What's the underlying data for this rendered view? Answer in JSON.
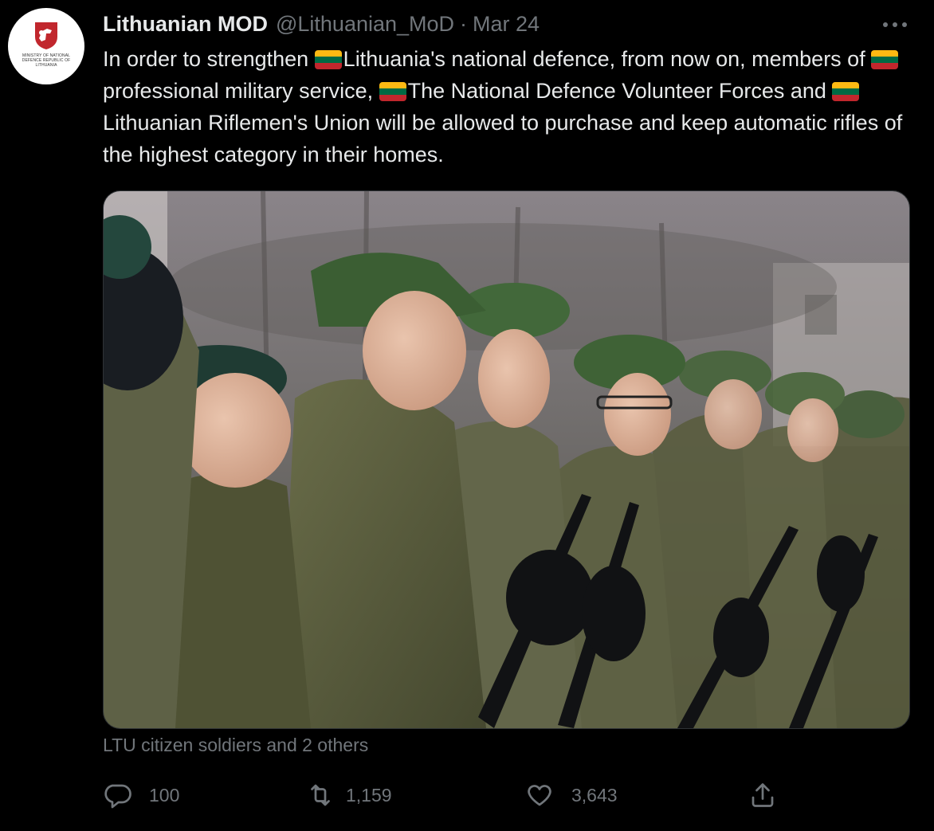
{
  "author": {
    "display_name": "Lithuanian MOD",
    "handle": "@Lithuanian_MoD",
    "separator": "·",
    "date": "Mar 24",
    "avatar_caption": "Ministry of National Defence Republic of Lithuania"
  },
  "tweet": {
    "segments": [
      {
        "text": "In order to strengthen ",
        "flag": false
      },
      {
        "text": "Lithuania's national defence, from now on, members of ",
        "flag": true
      },
      {
        "text": "professional military service, ",
        "flag": true
      },
      {
        "text": "The National Defence Volunteer Forces and ",
        "flag": true
      },
      {
        "text": "Lithuanian Riflemen's Union will be allowed to purchase and keep automatic rifles of the highest category in their homes.",
        "flag": true
      }
    ],
    "flag_emoji": "lithuania-flag-icon",
    "tagged_text": "LTU citizen soldiers and 2 others"
  },
  "media": {
    "kind": "photo",
    "subject": "soldiers-in-formation-photo"
  },
  "stats": {
    "replies": "100",
    "retweets": "1,159",
    "likes": "3,643"
  },
  "icons": {
    "reply": "reply-icon",
    "retweet": "retweet-icon",
    "like": "heart-icon",
    "share": "share-icon",
    "more": "more-options-icon"
  },
  "colors": {
    "background": "#000000",
    "text_primary": "#e7e9ea",
    "text_secondary": "#71767b",
    "flag_yellow": "#fdb913",
    "flag_green": "#006a44",
    "flag_red": "#c1272d"
  }
}
